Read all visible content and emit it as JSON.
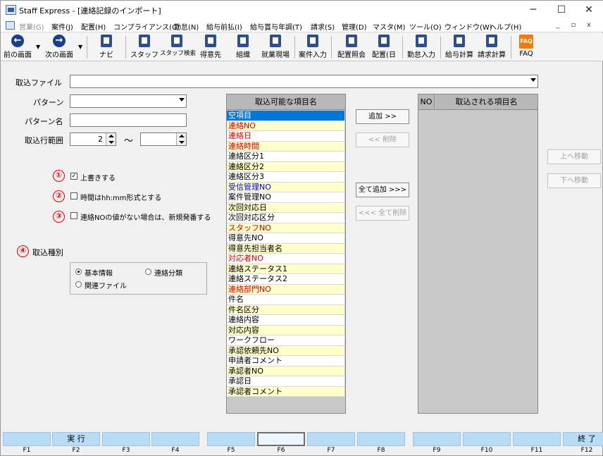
{
  "window": {
    "title": "Staff Express - [連絡記録のインポート]",
    "minimize": "─",
    "maximize": "☐",
    "close": "✕"
  },
  "menu": {
    "items": [
      "営業(G)",
      "案件(J)",
      "配置(H)",
      "コンプライアンス(C)",
      "勤怠(N)",
      "給与前払(I)",
      "給与賞与年調(T)",
      "請求(S)",
      "管理(D)",
      "マスタ(M)",
      "ツール(O)",
      "ウィンドウ(W)",
      "ヘルプ(H)"
    ],
    "disabled": [
      "営業(G)"
    ],
    "mdi_buttons": [
      "_",
      "▫",
      "x"
    ]
  },
  "toolbar": {
    "items": [
      "前の画面",
      "次の画面",
      "ナビ",
      "スタッフ",
      "スタッフ検索",
      "得意先",
      "組織",
      "就業現場",
      "案件入力",
      "配置照会",
      "配置(日",
      "勤怠入力",
      "給与計算",
      "請求計算",
      "FAQ"
    ]
  },
  "form": {
    "import_file_label": "取込ファイル",
    "import_file_value": "",
    "pattern_label": "パターン",
    "pattern_value": "",
    "pattern_name_label": "パターン名",
    "pattern_name_value": "",
    "row_range_label": "取込行範囲",
    "row_from": "2",
    "row_to": "",
    "tilde": "～"
  },
  "options": [
    {
      "num": "①",
      "label": "上書きする",
      "checked": true
    },
    {
      "num": "②",
      "label": "時間はhh:mm形式とする",
      "checked": false
    },
    {
      "num": "③",
      "label": "連絡NOの値がない場合は、新規発番する",
      "checked": false
    }
  ],
  "import_type": {
    "num": "④",
    "label": "取込種別",
    "radios": [
      {
        "label": "基本情報",
        "selected": true
      },
      {
        "label": "連絡分類",
        "selected": false
      },
      {
        "label": "関連ファイル",
        "selected": false
      }
    ]
  },
  "available_list": {
    "header": "取込可能な項目名",
    "items": [
      {
        "label": "空項目",
        "color": "black",
        "bg": "selected"
      },
      {
        "label": "連絡NO",
        "color": "red",
        "bg": "yellow"
      },
      {
        "label": "連絡日",
        "color": "red",
        "bg": "white"
      },
      {
        "label": "連絡時間",
        "color": "red",
        "bg": "yellow"
      },
      {
        "label": "連絡区分1",
        "color": "black",
        "bg": "white"
      },
      {
        "label": "連絡区分2",
        "color": "black",
        "bg": "yellow"
      },
      {
        "label": "連絡区分3",
        "color": "black",
        "bg": "white"
      },
      {
        "label": "受信管理NO",
        "color": "blue",
        "bg": "yellow"
      },
      {
        "label": "案件管理NO",
        "color": "black",
        "bg": "white"
      },
      {
        "label": "次回対応日",
        "color": "black",
        "bg": "yellow"
      },
      {
        "label": "次回対応区分",
        "color": "black",
        "bg": "white"
      },
      {
        "label": "スタッフNO",
        "color": "red",
        "bg": "yellow"
      },
      {
        "label": "得意先NO",
        "color": "black",
        "bg": "white"
      },
      {
        "label": "得意先担当者名",
        "color": "black",
        "bg": "yellow"
      },
      {
        "label": "対応者NO",
        "color": "red",
        "bg": "white"
      },
      {
        "label": "連絡ステータス1",
        "color": "black",
        "bg": "yellow"
      },
      {
        "label": "連絡ステータス2",
        "color": "black",
        "bg": "white"
      },
      {
        "label": "連絡部門NO",
        "color": "red",
        "bg": "yellow"
      },
      {
        "label": "件名",
        "color": "black",
        "bg": "white"
      },
      {
        "label": "件名区分",
        "color": "black",
        "bg": "yellow"
      },
      {
        "label": "連絡内容",
        "color": "black",
        "bg": "white"
      },
      {
        "label": "対応内容",
        "color": "black",
        "bg": "yellow"
      },
      {
        "label": "ワークフロー",
        "color": "black",
        "bg": "white"
      },
      {
        "label": "承認依頼先NO",
        "color": "black",
        "bg": "yellow"
      },
      {
        "label": "申請者コメント",
        "color": "black",
        "bg": "white"
      },
      {
        "label": "承認者NO",
        "color": "black",
        "bg": "yellow"
      },
      {
        "label": "承認日",
        "color": "black",
        "bg": "white"
      },
      {
        "label": "承認者コメント",
        "color": "black",
        "bg": "yellow"
      }
    ]
  },
  "selected_list": {
    "header_no": "NO",
    "header_name": "取込される項目名"
  },
  "buttons": {
    "add": "追加 >>",
    "remove": "<< 削除",
    "add_all": "全て追加 >>>",
    "remove_all": "<<< 全て削除",
    "move_up": "上へ移動",
    "move_down": "下へ移動"
  },
  "fkeys": [
    {
      "key": "F1",
      "label": ""
    },
    {
      "key": "F2",
      "label": "実 行"
    },
    {
      "key": "F3",
      "label": ""
    },
    {
      "key": "F4",
      "label": ""
    },
    {
      "key": "F5",
      "label": ""
    },
    {
      "key": "F6",
      "label": ""
    },
    {
      "key": "F7",
      "label": ""
    },
    {
      "key": "F8",
      "label": ""
    },
    {
      "key": "F9",
      "label": ""
    },
    {
      "key": "F10",
      "label": ""
    },
    {
      "key": "F11",
      "label": ""
    },
    {
      "key": "F12",
      "label": "終 了"
    }
  ]
}
